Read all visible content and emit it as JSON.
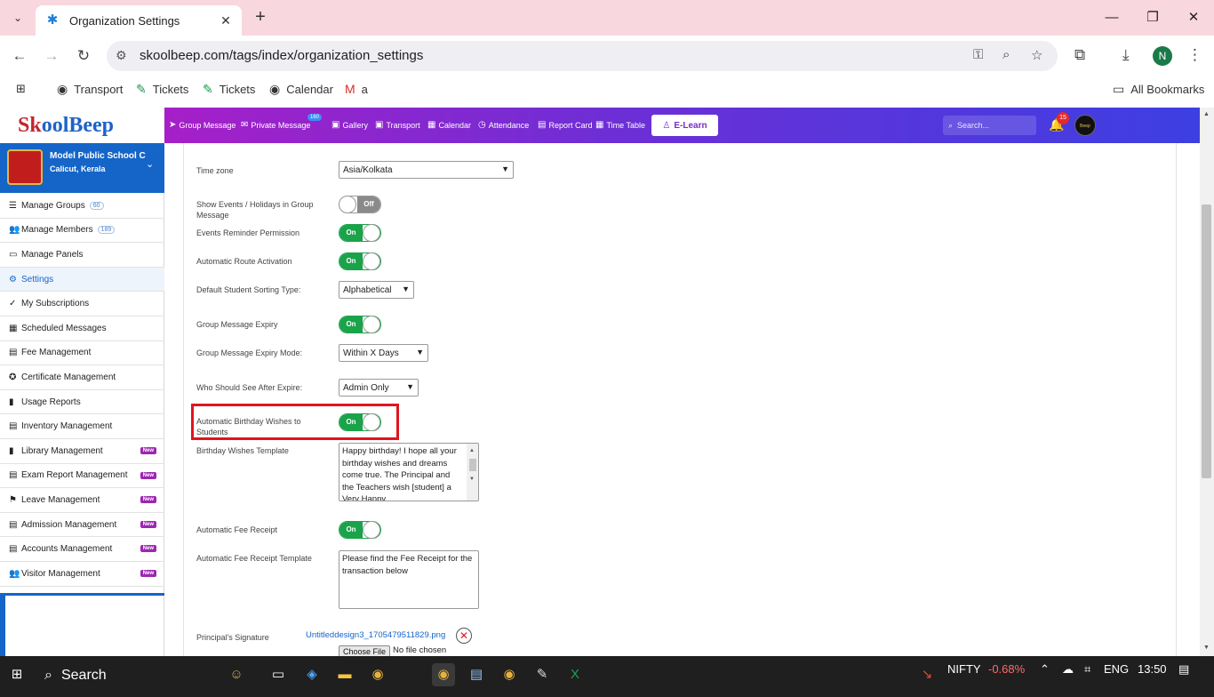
{
  "browser": {
    "tab_title": "Organization Settings",
    "url": "skoolbeep.com/tags/index/organization_settings",
    "profile_initial": "N",
    "bookmarks": [
      "Transport",
      "Tickets",
      "Tickets",
      "Calendar",
      "a"
    ],
    "all_bookmarks": "All Bookmarks"
  },
  "app": {
    "logo_k": "Sk",
    "logo_rest": "oolBeep",
    "nav": [
      "Group Message",
      "Private Message",
      "Gallery",
      "Transport",
      "Calendar",
      "Attendance",
      "Report Card",
      "Time Table"
    ],
    "private_badge": "160",
    "elearn": "E-Learn",
    "search_placeholder": "Search...",
    "notif_count": "15",
    "avatar_text": "Beep"
  },
  "school": {
    "name": "Model Public School C",
    "place": "Calicut, Kerala"
  },
  "sidebar": {
    "items": [
      {
        "label": "Manage Groups",
        "icon": "list-icon",
        "glyph": "☰",
        "count": "60"
      },
      {
        "label": "Manage Members",
        "icon": "members-icon",
        "glyph": "👥",
        "count": "189"
      },
      {
        "label": "Manage Panels",
        "icon": "monitor-icon",
        "glyph": "▭"
      },
      {
        "label": "Settings",
        "icon": "gear-icon",
        "glyph": "⚙",
        "active": true
      },
      {
        "label": "My Subscriptions",
        "icon": "check-icon",
        "glyph": "✓"
      },
      {
        "label": "Scheduled Messages",
        "icon": "calendar-icon",
        "glyph": "▦"
      },
      {
        "label": "Fee Management",
        "icon": "document-icon",
        "glyph": "▤"
      },
      {
        "label": "Certificate Management",
        "icon": "certificate-icon",
        "glyph": "✪"
      },
      {
        "label": "Usage Reports",
        "icon": "bar-chart-icon",
        "glyph": "▮"
      },
      {
        "label": "Inventory Management",
        "icon": "inventory-icon",
        "glyph": "▤"
      },
      {
        "label": "Library Management",
        "icon": "book-icon",
        "glyph": "▮",
        "badge": "New"
      },
      {
        "label": "Exam Report Management",
        "icon": "document-icon",
        "glyph": "▤",
        "badge": "New"
      },
      {
        "label": "Leave Management",
        "icon": "leave-icon",
        "glyph": "⚑",
        "badge": "New"
      },
      {
        "label": "Admission Management",
        "icon": "admission-icon",
        "glyph": "▤",
        "badge": "New"
      },
      {
        "label": "Accounts Management",
        "icon": "accounts-icon",
        "glyph": "▤",
        "badge": "New"
      },
      {
        "label": "Visitor Management",
        "icon": "visitor-icon",
        "glyph": "👥",
        "badge": "New"
      }
    ]
  },
  "settings": {
    "timezone_label": "Time zone",
    "timezone_value": "Asia/Kolkata",
    "show_events_label": "Show Events / Holidays in Group Message",
    "show_events_state": "Off",
    "events_reminder_label": "Events Reminder Permission",
    "events_reminder_state": "On",
    "auto_route_label": "Automatic Route Activation",
    "auto_route_state": "On",
    "sorting_label": "Default Student Sorting Type:",
    "sorting_value": "Alphabetical",
    "gm_expiry_label": "Group Message Expiry",
    "gm_expiry_state": "On",
    "gm_expiry_mode_label": "Group Message Expiry Mode:",
    "gm_expiry_mode_value": "Within X Days",
    "who_see_label": "Who Should See After Expire:",
    "who_see_value": "Admin Only",
    "birthday_label": "Automatic Birthday Wishes to Students",
    "birthday_state": "On",
    "birthday_template_label": "Birthday Wishes Template",
    "birthday_template_text": "Happy birthday! I hope all your birthday wishes and dreams come true. The Principal and the Teachers wish [student] a Very Happy",
    "fee_receipt_label": "Automatic Fee Receipt",
    "fee_receipt_state": "On",
    "fee_template_label": "Automatic Fee Receipt Template",
    "fee_template_text": "Please find the Fee Receipt for the transaction below",
    "signature_label": "Principal's Signature",
    "signature_file": "Untitleddesign3_1705479511829.png",
    "choose_file": "Choose File",
    "no_file": "No file chosen"
  },
  "taskbar": {
    "search": "Search",
    "stock_name": "NIFTY",
    "stock_change": "-0.68%",
    "lang": "ENG",
    "time": "13:50"
  },
  "colors": {
    "brand_blue": "#1565c8",
    "toggle_on": "#1aa34a",
    "highlight_red": "#e0141e",
    "new_badge": "#9c27b0"
  }
}
